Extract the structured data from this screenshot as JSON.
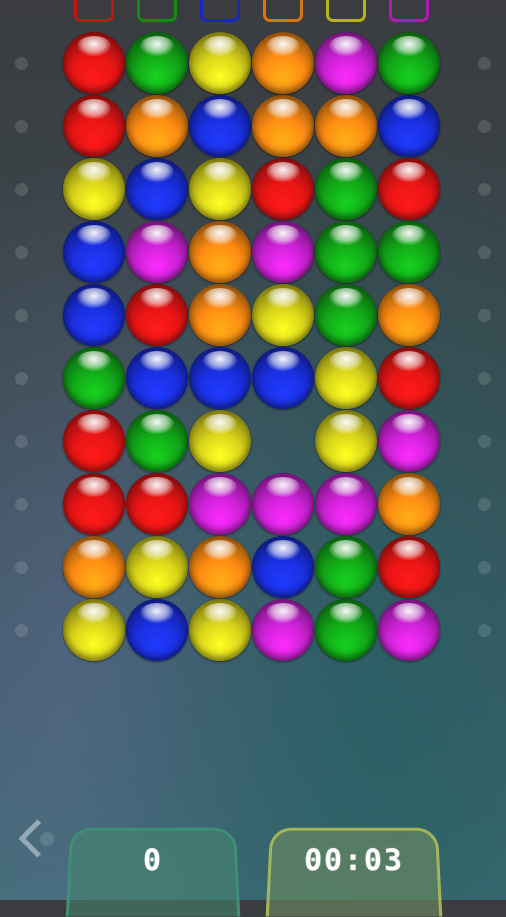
{
  "palette": {
    "red": "#e81515",
    "green": "#12a818",
    "yellow": "#d8d31a",
    "orange": "#ff8c12",
    "magenta": "#cc22d6",
    "blue": "#1a2fe0"
  },
  "bins": [
    "red",
    "green",
    "blue",
    "orange",
    "yellow",
    "magenta"
  ],
  "grid": [
    [
      "red",
      "green",
      "yellow",
      "orange",
      "magenta",
      "green"
    ],
    [
      "red",
      "orange",
      "blue",
      "orange",
      "orange",
      "blue"
    ],
    [
      "yellow",
      "blue",
      "yellow",
      "red",
      "green",
      "red"
    ],
    [
      "blue",
      "magenta",
      "orange",
      "magenta",
      "green",
      "green"
    ],
    [
      "blue",
      "red",
      "orange",
      "yellow",
      "green",
      "orange"
    ],
    [
      "green",
      "blue",
      "blue",
      "blue",
      "yellow",
      "red"
    ],
    [
      "red",
      "green",
      "yellow",
      null,
      "yellow",
      "magenta"
    ],
    [
      "red",
      "red",
      "magenta",
      "magenta",
      "magenta",
      "orange"
    ],
    [
      "orange",
      "yellow",
      "orange",
      "blue",
      "green",
      "red"
    ],
    [
      "yellow",
      "blue",
      "yellow",
      "magenta",
      "green",
      "magenta"
    ]
  ],
  "score": "0",
  "timer": "00:03"
}
